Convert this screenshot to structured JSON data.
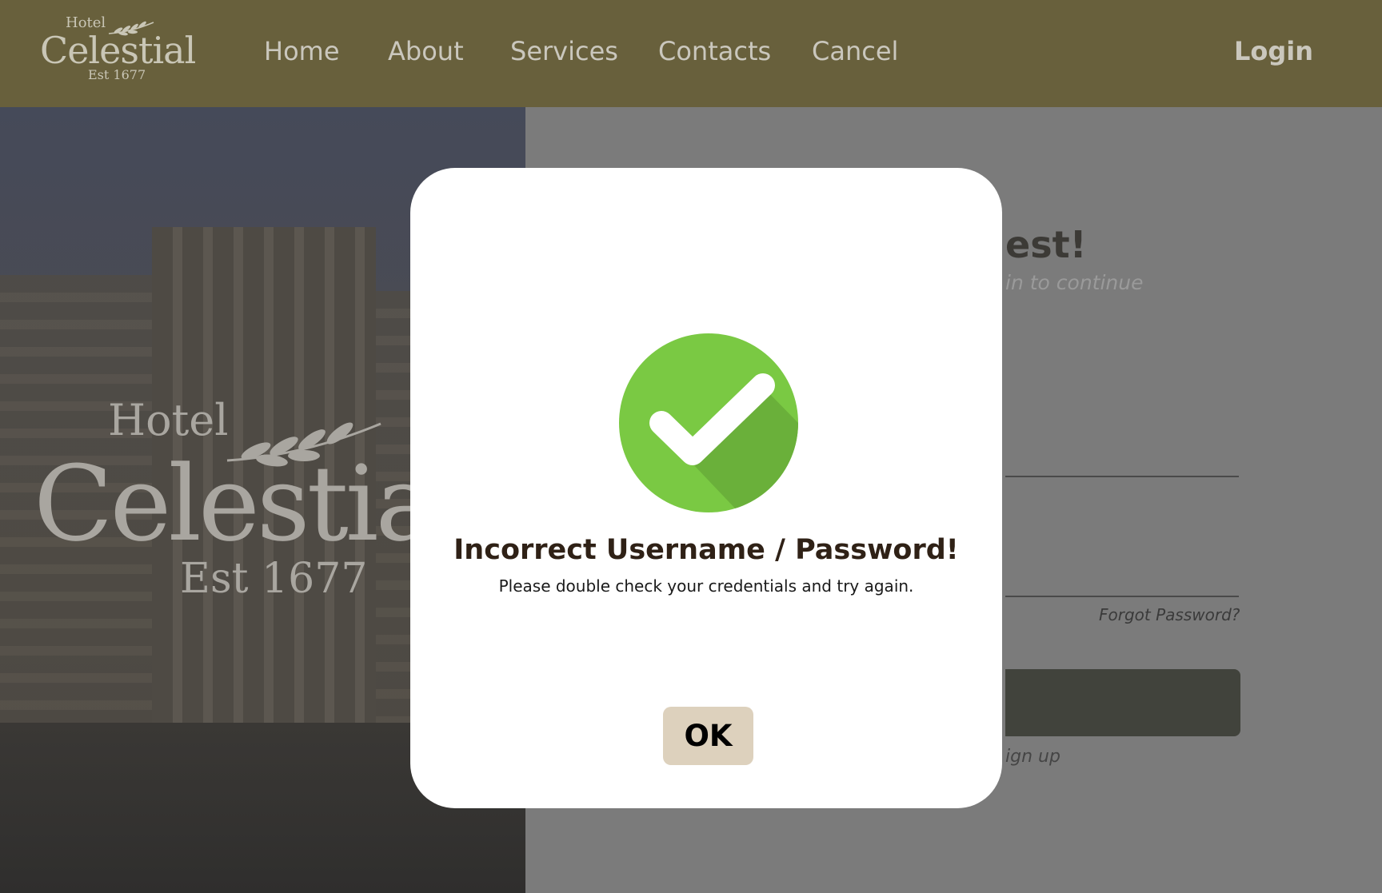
{
  "header": {
    "logo": {
      "top": "Hotel",
      "name": "Celestial",
      "est": "Est 1677"
    },
    "nav": [
      {
        "label": "Home"
      },
      {
        "label": "About"
      },
      {
        "label": "Services"
      },
      {
        "label": "Contacts"
      },
      {
        "label": "Cancel"
      }
    ],
    "login_label": "Login"
  },
  "hero": {
    "logo": {
      "top": "Hotel",
      "name": "Celestia",
      "est": "Est 1677"
    }
  },
  "form": {
    "heading_visible": "est!",
    "subtitle_visible": "in to continue",
    "forgot_label": "Forgot Password?",
    "signup_visible": "ign up"
  },
  "modal": {
    "icon": "check-circle-icon",
    "title": "Incorrect Username / Password!",
    "message": "Please double check your credentials and try again.",
    "ok_label": "OK"
  },
  "colors": {
    "header_bg": "#68603c",
    "overlay_bg": "#7b7b7b",
    "check_green": "#7ac943",
    "check_shadow": "#6ab03a",
    "ok_button_bg": "#ddd1bd",
    "title_color": "#2f2116"
  }
}
